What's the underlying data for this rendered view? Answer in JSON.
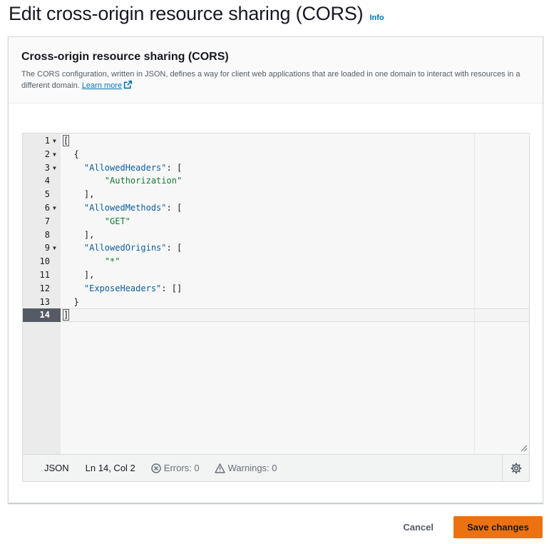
{
  "page": {
    "title": "Edit cross-origin resource sharing (CORS)",
    "info_label": "Info"
  },
  "panel": {
    "title": "Cross-origin resource sharing (CORS)",
    "description": "The CORS configuration, written in JSON, defines a way for client web applications that are loaded in one domain to interact with resources in a different domain.",
    "learn_more": "Learn more"
  },
  "editor": {
    "lines": [
      {
        "n": "1",
        "fold": true,
        "text": "["
      },
      {
        "n": "2",
        "fold": true,
        "text": "  {"
      },
      {
        "n": "3",
        "fold": true,
        "key": "\"AllowedHeaders\"",
        "rest": ": ["
      },
      {
        "n": "4",
        "fold": false,
        "str": "\"Authorization\""
      },
      {
        "n": "5",
        "fold": false,
        "text": "    ],"
      },
      {
        "n": "6",
        "fold": true,
        "key": "\"AllowedMethods\"",
        "rest": ": ["
      },
      {
        "n": "7",
        "fold": false,
        "str": "\"GET\""
      },
      {
        "n": "8",
        "fold": false,
        "text": "    ],"
      },
      {
        "n": "9",
        "fold": true,
        "key": "\"AllowedOrigins\"",
        "rest": ": ["
      },
      {
        "n": "10",
        "fold": false,
        "str": "\"*\""
      },
      {
        "n": "11",
        "fold": false,
        "text": "    ],"
      },
      {
        "n": "12",
        "fold": false,
        "key": "\"ExposeHeaders\"",
        "rest": ": []"
      },
      {
        "n": "13",
        "fold": false,
        "text": "  }"
      },
      {
        "n": "14",
        "fold": false,
        "text": "]"
      }
    ],
    "status": {
      "mode": "JSON",
      "position": "Ln 14, Col 2",
      "errors": "Errors: 0",
      "warnings": "Warnings: 0"
    }
  },
  "actions": {
    "cancel": "Cancel",
    "save": "Save changes"
  },
  "colors": {
    "primary_button": "#ec7211",
    "link": "#0073bb",
    "json_key": "#0a5fa0",
    "json_string": "#127a35"
  }
}
